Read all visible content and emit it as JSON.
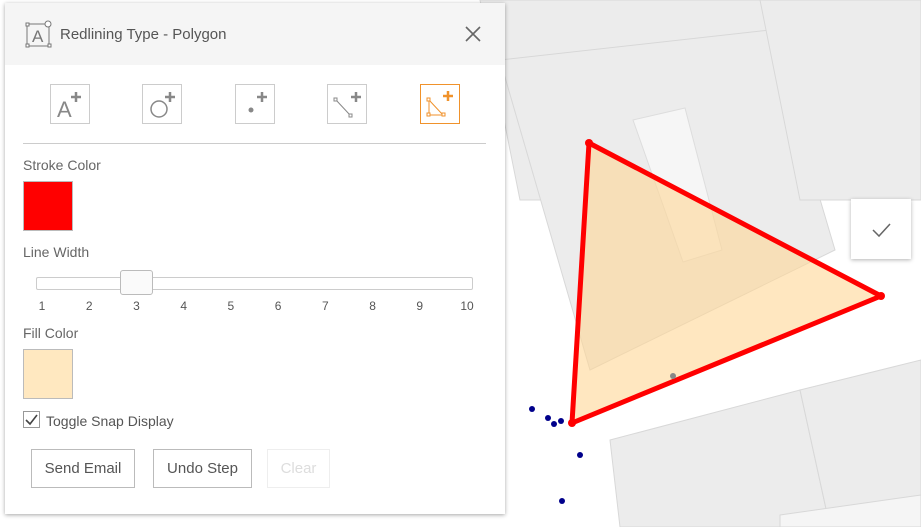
{
  "panel": {
    "title": "Redlining Type - Polygon",
    "tools": [
      {
        "name": "text",
        "active": false
      },
      {
        "name": "circle",
        "active": false
      },
      {
        "name": "point",
        "active": false
      },
      {
        "name": "line",
        "active": false
      },
      {
        "name": "polygon",
        "active": true
      }
    ],
    "stroke_color_label": "Stroke Color",
    "stroke_color": "#ff0000",
    "line_width_label": "Line Width",
    "line_width": {
      "value": 3,
      "min": 1,
      "max": 10,
      "ticks": [
        "1",
        "2",
        "3",
        "4",
        "5",
        "6",
        "7",
        "8",
        "9",
        "10"
      ]
    },
    "fill_color_label": "Fill Color",
    "fill_color": "#ffe8c0",
    "snap_label": "Toggle Snap Display",
    "snap_checked": true,
    "buttons": {
      "send_email": "Send Email",
      "undo": "Undo Step",
      "clear": "Clear"
    }
  },
  "colors": {
    "accent": "#f0922b",
    "polygon_stroke": "#ff0000"
  }
}
